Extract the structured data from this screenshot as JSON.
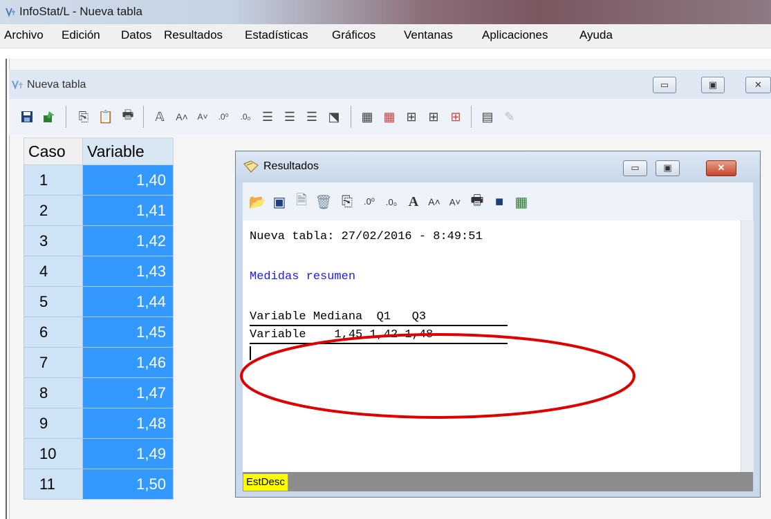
{
  "app": {
    "title": "InfoStat/L - Nueva tabla"
  },
  "menu": [
    "Archivo",
    "Edición",
    "Datos",
    "Resultados",
    "Estadísticas",
    "Gráficos",
    "Ventanas",
    "Aplicaciones",
    "Ayuda"
  ],
  "child": {
    "title": "Nueva tabla",
    "buttons": {
      "minimize": "▭",
      "maximize": "▣",
      "close": "✕"
    }
  },
  "grid": {
    "columns": [
      "Caso",
      "Variable"
    ],
    "rows": [
      {
        "caso": "1",
        "value": "1,40"
      },
      {
        "caso": "2",
        "value": "1,41"
      },
      {
        "caso": "3",
        "value": "1,42"
      },
      {
        "caso": "4",
        "value": "1,43"
      },
      {
        "caso": "5",
        "value": "1,44"
      },
      {
        "caso": "6",
        "value": "1,45"
      },
      {
        "caso": "7",
        "value": "1,46"
      },
      {
        "caso": "8",
        "value": "1,47"
      },
      {
        "caso": "9",
        "value": "1,48"
      },
      {
        "caso": "10",
        "value": "1,49"
      },
      {
        "caso": "11",
        "value": "1,50"
      }
    ]
  },
  "results": {
    "title": "Resultados",
    "header_line": "Nueva tabla: 27/02/2016 - 8:49:51",
    "section": "Medidas resumen",
    "table_header": "Variable Mediana  Q1   Q3",
    "table_row": "Variable    1,45 1,42 1,48",
    "status_tab": "EstDesc"
  },
  "colors": {
    "selection": "#3399ff",
    "case_col": "#cfe3f7",
    "annotation": "#e00000",
    "status_tab": "#ffff00"
  }
}
